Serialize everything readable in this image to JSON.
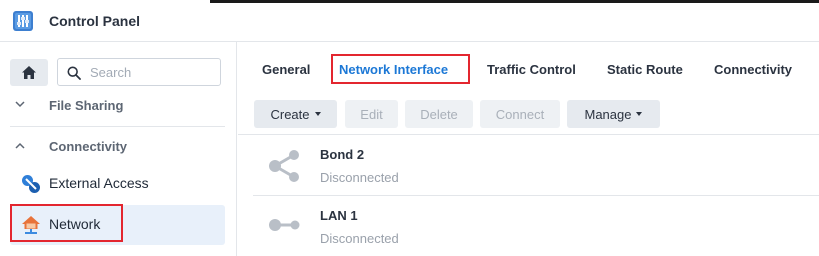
{
  "window": {
    "title": "Control Panel",
    "icon": "control-panel-icon"
  },
  "sidebar": {
    "home_icon": "home-icon",
    "search_placeholder": "Search",
    "search_value": "",
    "sections": [
      {
        "label": "File Sharing",
        "state": "collapsed",
        "icon": "chevron-down-icon"
      },
      {
        "label": "Connectivity",
        "state": "expanded",
        "icon": "chevron-up-icon"
      }
    ],
    "items": [
      {
        "label": "External Access",
        "icon": "external-access-icon",
        "active": false
      },
      {
        "label": "Network",
        "icon": "network-house-icon",
        "active": true
      }
    ]
  },
  "tabs": [
    {
      "label": "General",
      "active": false
    },
    {
      "label": "Network Interface",
      "active": true
    },
    {
      "label": "Traffic Control",
      "active": false
    },
    {
      "label": "Static Route",
      "active": false
    },
    {
      "label": "Connectivity",
      "active": false
    }
  ],
  "toolbar": {
    "buttons": [
      {
        "label": "Create",
        "dropdown": true,
        "enabled": true
      },
      {
        "label": "Edit",
        "dropdown": false,
        "enabled": false
      },
      {
        "label": "Delete",
        "dropdown": false,
        "enabled": false
      },
      {
        "label": "Connect",
        "dropdown": false,
        "enabled": false
      },
      {
        "label": "Manage",
        "dropdown": true,
        "enabled": true
      }
    ]
  },
  "interfaces": [
    {
      "name": "Bond 2",
      "status": "Disconnected",
      "icon": "bond-share-icon"
    },
    {
      "name": "LAN 1",
      "status": "Disconnected",
      "icon": "lan-link-icon"
    }
  ],
  "colors": {
    "accent": "#1c78d6",
    "highlight_box": "#e3262f",
    "active_item_bg": "#e8f0fa",
    "button_bg": "#e6eaef",
    "muted_text": "#9aa1ab"
  }
}
